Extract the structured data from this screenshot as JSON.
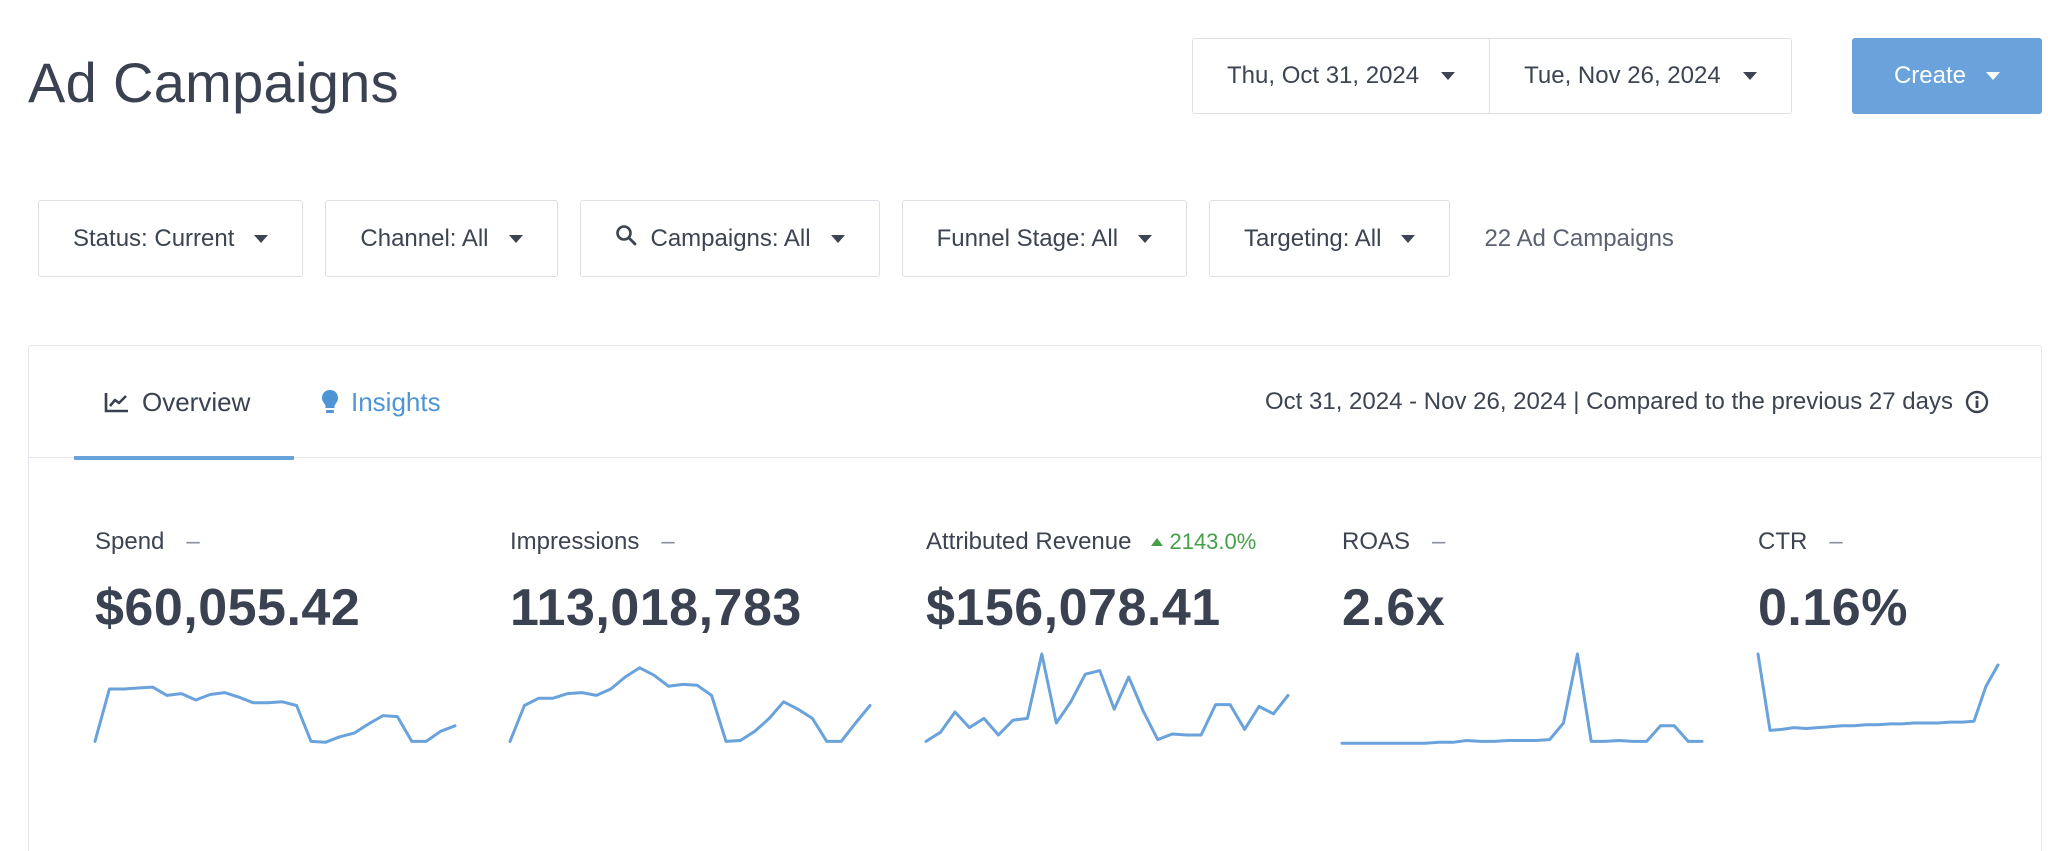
{
  "header": {
    "title": "Ad Campaigns",
    "start_date": "Thu, Oct 31, 2024",
    "end_date": "Tue, Nov 26, 2024",
    "create_label": "Create"
  },
  "filters": {
    "status": "Status: Current",
    "channel": "Channel: All",
    "campaigns": "Campaigns: All",
    "funnel_stage": "Funnel Stage: All",
    "targeting": "Targeting: All",
    "count": "22 Ad Campaigns"
  },
  "tabs": {
    "overview": "Overview",
    "insights": "Insights"
  },
  "compare_text": "Oct 31, 2024 - Nov 26, 2024 | Compared to the previous 27 days",
  "metrics": [
    {
      "label": "Spend",
      "dash": "–",
      "change": "",
      "value": "$60,055.42",
      "trend": [
        0.05,
        0.62,
        0.62,
        0.63,
        0.64,
        0.55,
        0.57,
        0.5,
        0.56,
        0.58,
        0.53,
        0.47,
        0.47,
        0.48,
        0.44,
        0.05,
        0.04,
        0.1,
        0.14,
        0.24,
        0.33,
        0.32,
        0.05,
        0.05,
        0.16,
        0.22
      ]
    },
    {
      "label": "Impressions",
      "dash": "–",
      "change": "",
      "value": "113,018,783",
      "trend": [
        0.05,
        0.44,
        0.52,
        0.52,
        0.57,
        0.58,
        0.55,
        0.62,
        0.75,
        0.85,
        0.77,
        0.65,
        0.67,
        0.66,
        0.55,
        0.05,
        0.06,
        0.16,
        0.3,
        0.48,
        0.4,
        0.3,
        0.05,
        0.05,
        0.25,
        0.44
      ]
    },
    {
      "label": "Attributed Revenue",
      "dash": "",
      "change": "2143.0%",
      "value": "$156,078.41",
      "trend": [
        0.05,
        0.15,
        0.37,
        0.2,
        0.3,
        0.12,
        0.28,
        0.3,
        1.0,
        0.25,
        0.48,
        0.78,
        0.82,
        0.4,
        0.75,
        0.38,
        0.07,
        0.13,
        0.12,
        0.12,
        0.45,
        0.45,
        0.18,
        0.43,
        0.35,
        0.55
      ]
    },
    {
      "label": "ROAS",
      "dash": "–",
      "change": "",
      "value": "2.6x",
      "trend": [
        0.03,
        0.03,
        0.03,
        0.03,
        0.03,
        0.03,
        0.03,
        0.04,
        0.04,
        0.06,
        0.05,
        0.05,
        0.06,
        0.06,
        0.06,
        0.07,
        0.25,
        1.0,
        0.05,
        0.05,
        0.06,
        0.05,
        0.05,
        0.22,
        0.22,
        0.05,
        0.05
      ]
    },
    {
      "label": "CTR",
      "dash": "–",
      "change": "",
      "value": "0.16%",
      "trend": [
        1.0,
        0.17,
        0.18,
        0.2,
        0.19,
        0.2,
        0.21,
        0.22,
        0.22,
        0.23,
        0.23,
        0.24,
        0.24,
        0.25,
        0.25,
        0.25,
        0.26,
        0.26,
        0.27,
        0.65,
        0.88
      ]
    }
  ],
  "colors": {
    "accent": "#6aa2db",
    "positive": "#45a04a",
    "text": "#3d4451"
  },
  "icons": {
    "date_caret": "chevron-down-icon",
    "search": "search-icon",
    "overview": "line-chart-icon",
    "insights": "lightbulb-icon",
    "info": "info-icon"
  }
}
